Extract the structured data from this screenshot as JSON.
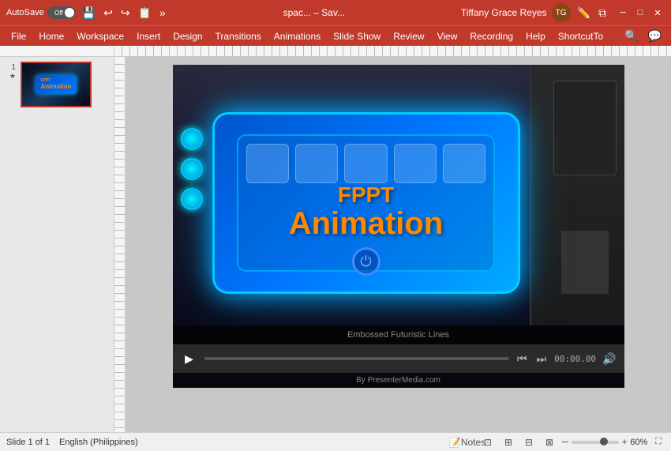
{
  "titlebar": {
    "autosave_label": "AutoSave",
    "toggle_state": "Off",
    "title": "spac... – Sav...",
    "user_name": "Tiffany Grace Reyes",
    "user_initials": "TG"
  },
  "menubar": {
    "items": [
      "File",
      "Home",
      "Workspace",
      "Insert",
      "Design",
      "Transitions",
      "Animations",
      "Slide Show",
      "Review",
      "View",
      "Recording",
      "Help",
      "ShortcutTo"
    ]
  },
  "slide_panel": {
    "slide_number": "1",
    "slide_star": "★"
  },
  "slide": {
    "fppt_label": "FPPT",
    "animation_label": "Animation",
    "subtitle_label": "Embossed Futuristic Lines",
    "watermark": "By PresenterMedia.com"
  },
  "video_controls": {
    "time": "00:00.00",
    "play_label": "▶",
    "skip_back": "⏮",
    "skip_fwd": "⏭",
    "volume": "🔊"
  },
  "statusbar": {
    "slide_info": "Slide 1 of 1",
    "language": "English (Philippines)",
    "notes_label": "Notes",
    "zoom_percent": "60%"
  }
}
